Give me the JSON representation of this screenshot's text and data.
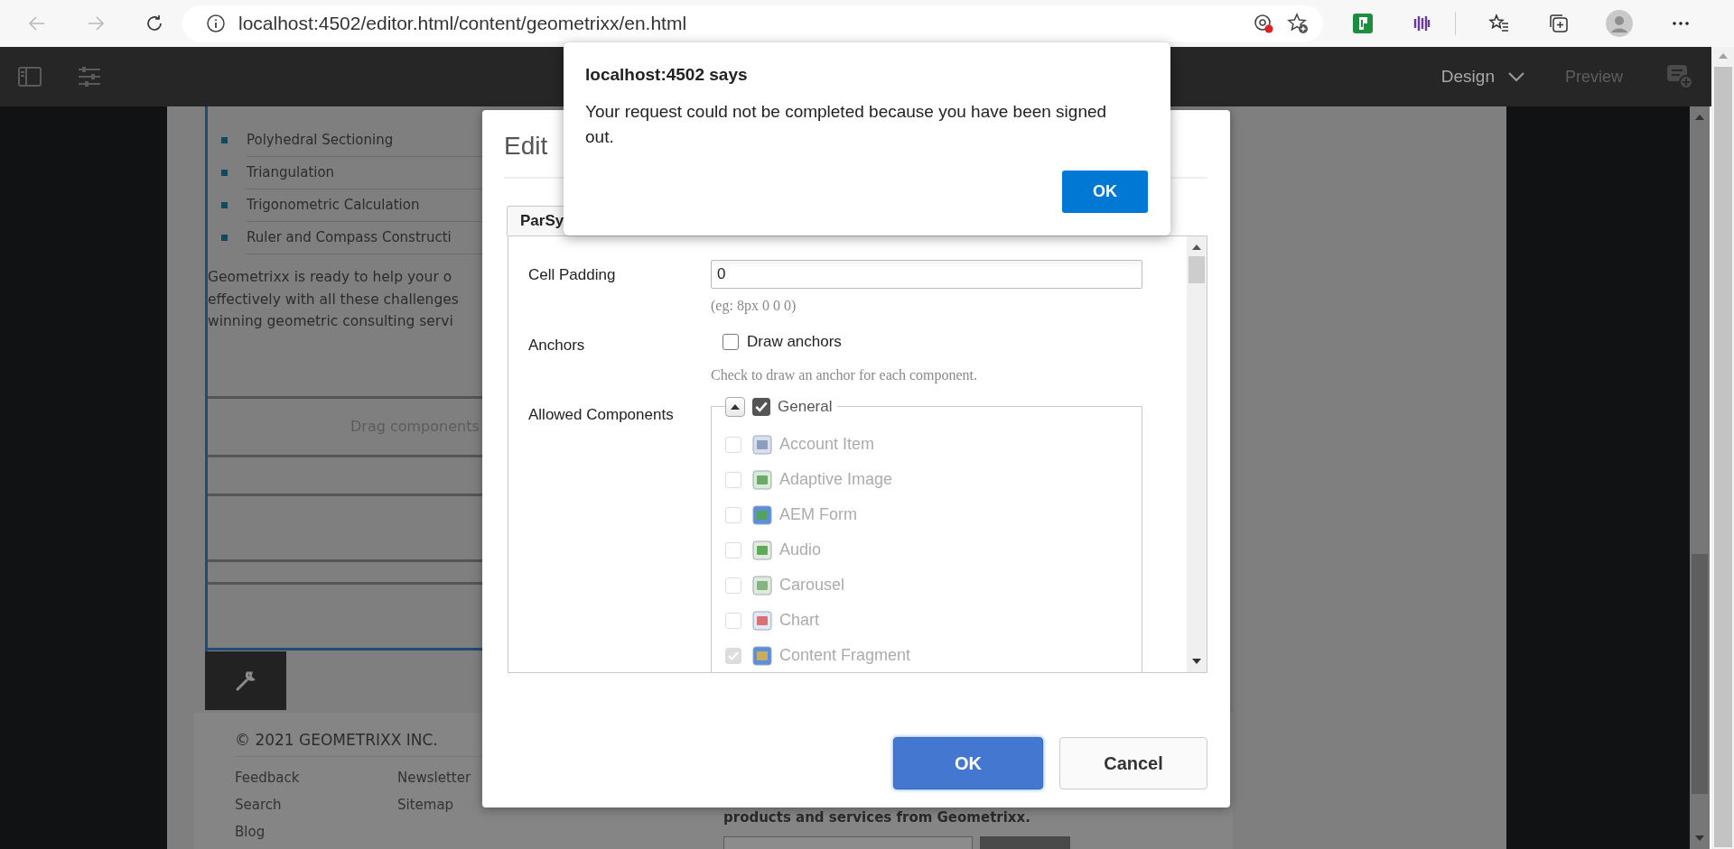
{
  "browser": {
    "url": "localhost:4502/editor.html/content/geometrixx/en.html"
  },
  "editor_toolbar": {
    "mode": "Design",
    "preview": "Preview"
  },
  "page": {
    "list": [
      "Polyhedral Sectioning",
      "Triangulation",
      "Trigonometric Calculation",
      "Ruler and Compass Constructi"
    ],
    "paragraph": [
      "Geometrixx is ready to help your o",
      "effectively with all these challenges",
      "winning geometric consulting servi"
    ],
    "drop_zone": "Drag components",
    "footer": {
      "copyright": "© 2021 GEOMETRIXX INC.",
      "link_columns": [
        [
          "Feedback",
          "Search",
          "Blog"
        ],
        [
          "Newsletter",
          "Sitemap"
        ]
      ],
      "signup_text": "products and services from Geometrixx."
    }
  },
  "dialog": {
    "title": "Edit",
    "tabs": [
      {
        "label": "ParSy",
        "selected": true
      }
    ],
    "cell_padding": {
      "label": "Cell Padding",
      "value": "0",
      "hint": "(eg: 8px 0 0 0)"
    },
    "anchors": {
      "label": "Anchors",
      "option": "Draw anchors",
      "checked": false,
      "hint": "Check to draw an anchor for each component."
    },
    "allowed_components": {
      "label": "Allowed Components",
      "group": {
        "label": "General",
        "expanded": true,
        "checked": true,
        "items": [
          {
            "label": "Account Item",
            "checked": false,
            "disabled": true
          },
          {
            "label": "Adaptive Image",
            "checked": false,
            "disabled": true
          },
          {
            "label": "AEM Form",
            "checked": false,
            "disabled": true
          },
          {
            "label": "Audio",
            "checked": false,
            "disabled": true
          },
          {
            "label": "Carousel",
            "checked": false,
            "disabled": true
          },
          {
            "label": "Chart",
            "checked": false,
            "disabled": true
          },
          {
            "label": "Content Fragment",
            "checked": true,
            "disabled": true
          }
        ]
      }
    },
    "buttons": [
      {
        "label": "OK",
        "kind": "primary"
      },
      {
        "label": "Cancel",
        "kind": "secondary"
      }
    ]
  },
  "alert": {
    "title": "localhost:4502 says",
    "message": "Your request could not be completed because you have been signed out.",
    "button": "OK"
  }
}
